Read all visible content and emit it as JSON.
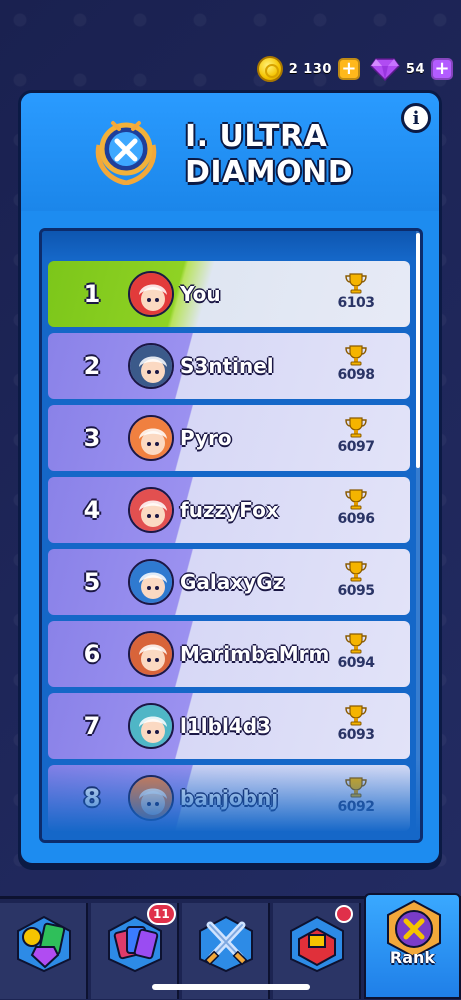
{
  "resources": {
    "coins": "2 130",
    "gems": "54"
  },
  "panel": {
    "title_line1": "I. ULTRA",
    "title_line2": "DIAMOND",
    "info_label": "i"
  },
  "leaderboard": [
    {
      "rank": "1",
      "name": "You",
      "trophies": "6103",
      "avatar_color": "#e23b3b"
    },
    {
      "rank": "2",
      "name": "S3ntinel",
      "trophies": "6098",
      "avatar_color": "#3b5a8a"
    },
    {
      "rank": "3",
      "name": "Pyro",
      "trophies": "6097",
      "avatar_color": "#f08040"
    },
    {
      "rank": "4",
      "name": "fuzzyFox",
      "trophies": "6096",
      "avatar_color": "#e25050"
    },
    {
      "rank": "5",
      "name": "GalaxyGz",
      "trophies": "6095",
      "avatar_color": "#2f7ad0"
    },
    {
      "rank": "6",
      "name": "MarimbaMrm",
      "trophies": "6094",
      "avatar_color": "#d8643a"
    },
    {
      "rank": "7",
      "name": "l1lbl4d3",
      "trophies": "6093",
      "avatar_color": "#4fb6c6"
    },
    {
      "rank": "8",
      "name": "banjobnj",
      "trophies": "6092",
      "avatar_color": "#f08040"
    }
  ],
  "nav": {
    "cards_badge": "11",
    "rank_label": "Rank"
  },
  "colors": {
    "panel_blue": "#1d8cf0",
    "you_row_green": "#7cc61a",
    "row_purple": "#8a82e8",
    "trophy_gold": "#f5b400"
  }
}
